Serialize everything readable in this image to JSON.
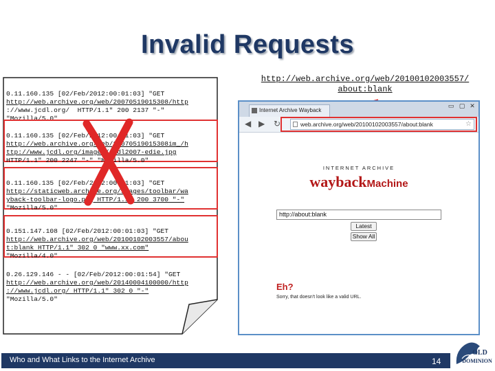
{
  "slide": {
    "title": "Invalid Requests",
    "footer_text": "Who and What Links to the Internet Archive",
    "page_number": "14",
    "logo_text_1": "OLD",
    "logo_text_2": "DOMINION"
  },
  "log_entries": [
    {
      "lines": [
        "0.11.160.135 [02/Feb/2012:00:01:03] \"GET",
        "http://web.archive.org/web/20070519015308/http",
        "://www.jcdl.org/  HTTP/1.1\" 200 2137 \"-\"",
        "\"Mozilla/5.0\""
      ],
      "crossed_out": false
    },
    {
      "lines": [
        "0.11.160.135 [02/Feb/2012:00:01:03] \"GET",
        "http://web.archive.org/web/20070519015308im_/h",
        "ttp://www.jcdl.org/images/jcdl2007-edie.jpg",
        "HTTP/1.1\" 200 2247 \"-\" \"Mozilla/5.0\""
      ],
      "crossed_out": true
    },
    {
      "lines": [
        "0.11.160.135 [02/Feb/2012:00:01:03] \"GET",
        "http://staticweb.archive.org/images/toolbar/wa",
        "yback-toolbar-logo.png HTTP/1.1\" 200 3700 \"-\"",
        "\"Mozilla/5.0\""
      ],
      "crossed_out": true
    },
    {
      "lines": [
        "0.151.147.108 [02/Feb/2012:00:01:03] \"GET",
        "http://web.archive.org/web/20100102003557/abou",
        "t:blank HTTP/1.1\" 302 0 \"www.xx.com\"",
        "\"Mozilla/4.0\""
      ],
      "crossed_out": false
    },
    {
      "lines": [
        "0.26.129.146 - - [02/Feb/2012:00:01:54] \"GET",
        "http://web.archive.org/web/20140004100000/http",
        "://www.jcdl.org/ HTTP/1.1\" 302 0 \"-\"",
        "\"Mozilla/5.0\""
      ],
      "crossed_out": false
    }
  ],
  "url_caption": {
    "line1": "http://web.archive.org/web/20100102003557/",
    "line2": "about:blank"
  },
  "browser": {
    "tab_title": "Internet Archive Wayback",
    "address": "web.archive.org/web/20100102003557/about:blank",
    "minimize": "▭",
    "maximize": "▢",
    "close": "✕",
    "back": "◀",
    "forward": "▶",
    "reload": "↻",
    "bookmark": "☆",
    "ia_heading": "INTERNET ARCHIVE",
    "wayback_word": "wayback",
    "machine_word": "Machine",
    "search_value": "http://about:blank",
    "latest_button": "Latest",
    "show_all_button": "Show All",
    "error_heading": "Eh?",
    "error_text": "Sorry, that doesn't look like a valid URL."
  },
  "colors": {
    "title": "#1f3864",
    "footer_bg": "#1f3864",
    "red_highlight": "#e03030",
    "x_mark": "#e02828",
    "screenshot_border": "#5b8fc7"
  }
}
